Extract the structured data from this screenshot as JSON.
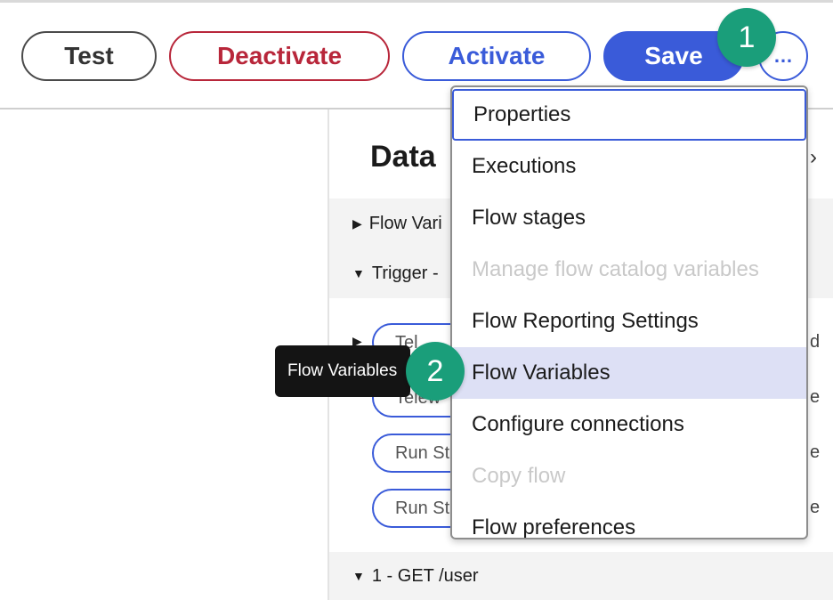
{
  "toolbar": {
    "test_label": "Test",
    "deactivate_label": "Deactivate",
    "activate_label": "Activate",
    "save_label": "Save",
    "more_label": "…"
  },
  "badges": {
    "step1": "1",
    "step2": "2"
  },
  "panel": {
    "title": "Data",
    "chevron": "›",
    "rows": {
      "flow_vars": "Flow Vari",
      "trigger": "Trigger -",
      "get_user": "1 - GET /user"
    },
    "pills": [
      {
        "label": "Tel",
        "right": "d"
      },
      {
        "label": "Telew",
        "right": "e"
      },
      {
        "label": "Run St",
        "right": "e"
      },
      {
        "label": "Run St",
        "right": "e"
      }
    ]
  },
  "menu": {
    "items": [
      {
        "label": "Properties",
        "state": "focused"
      },
      {
        "label": "Executions",
        "state": "normal"
      },
      {
        "label": "Flow stages",
        "state": "normal"
      },
      {
        "label": "Manage flow catalog variables",
        "state": "disabled"
      },
      {
        "label": "Flow Reporting Settings",
        "state": "normal"
      },
      {
        "label": "Flow Variables",
        "state": "highlighted"
      },
      {
        "label": "Configure connections",
        "state": "normal"
      },
      {
        "label": "Copy flow",
        "state": "disabled"
      },
      {
        "label": "Flow preferences",
        "state": "normal"
      }
    ]
  },
  "tooltip": {
    "text": "Flow Variables"
  },
  "colors": {
    "accent": "#3a5bd9",
    "danger": "#b8263a",
    "badge": "#1a9e7a",
    "highlight": "#dde0f5"
  }
}
